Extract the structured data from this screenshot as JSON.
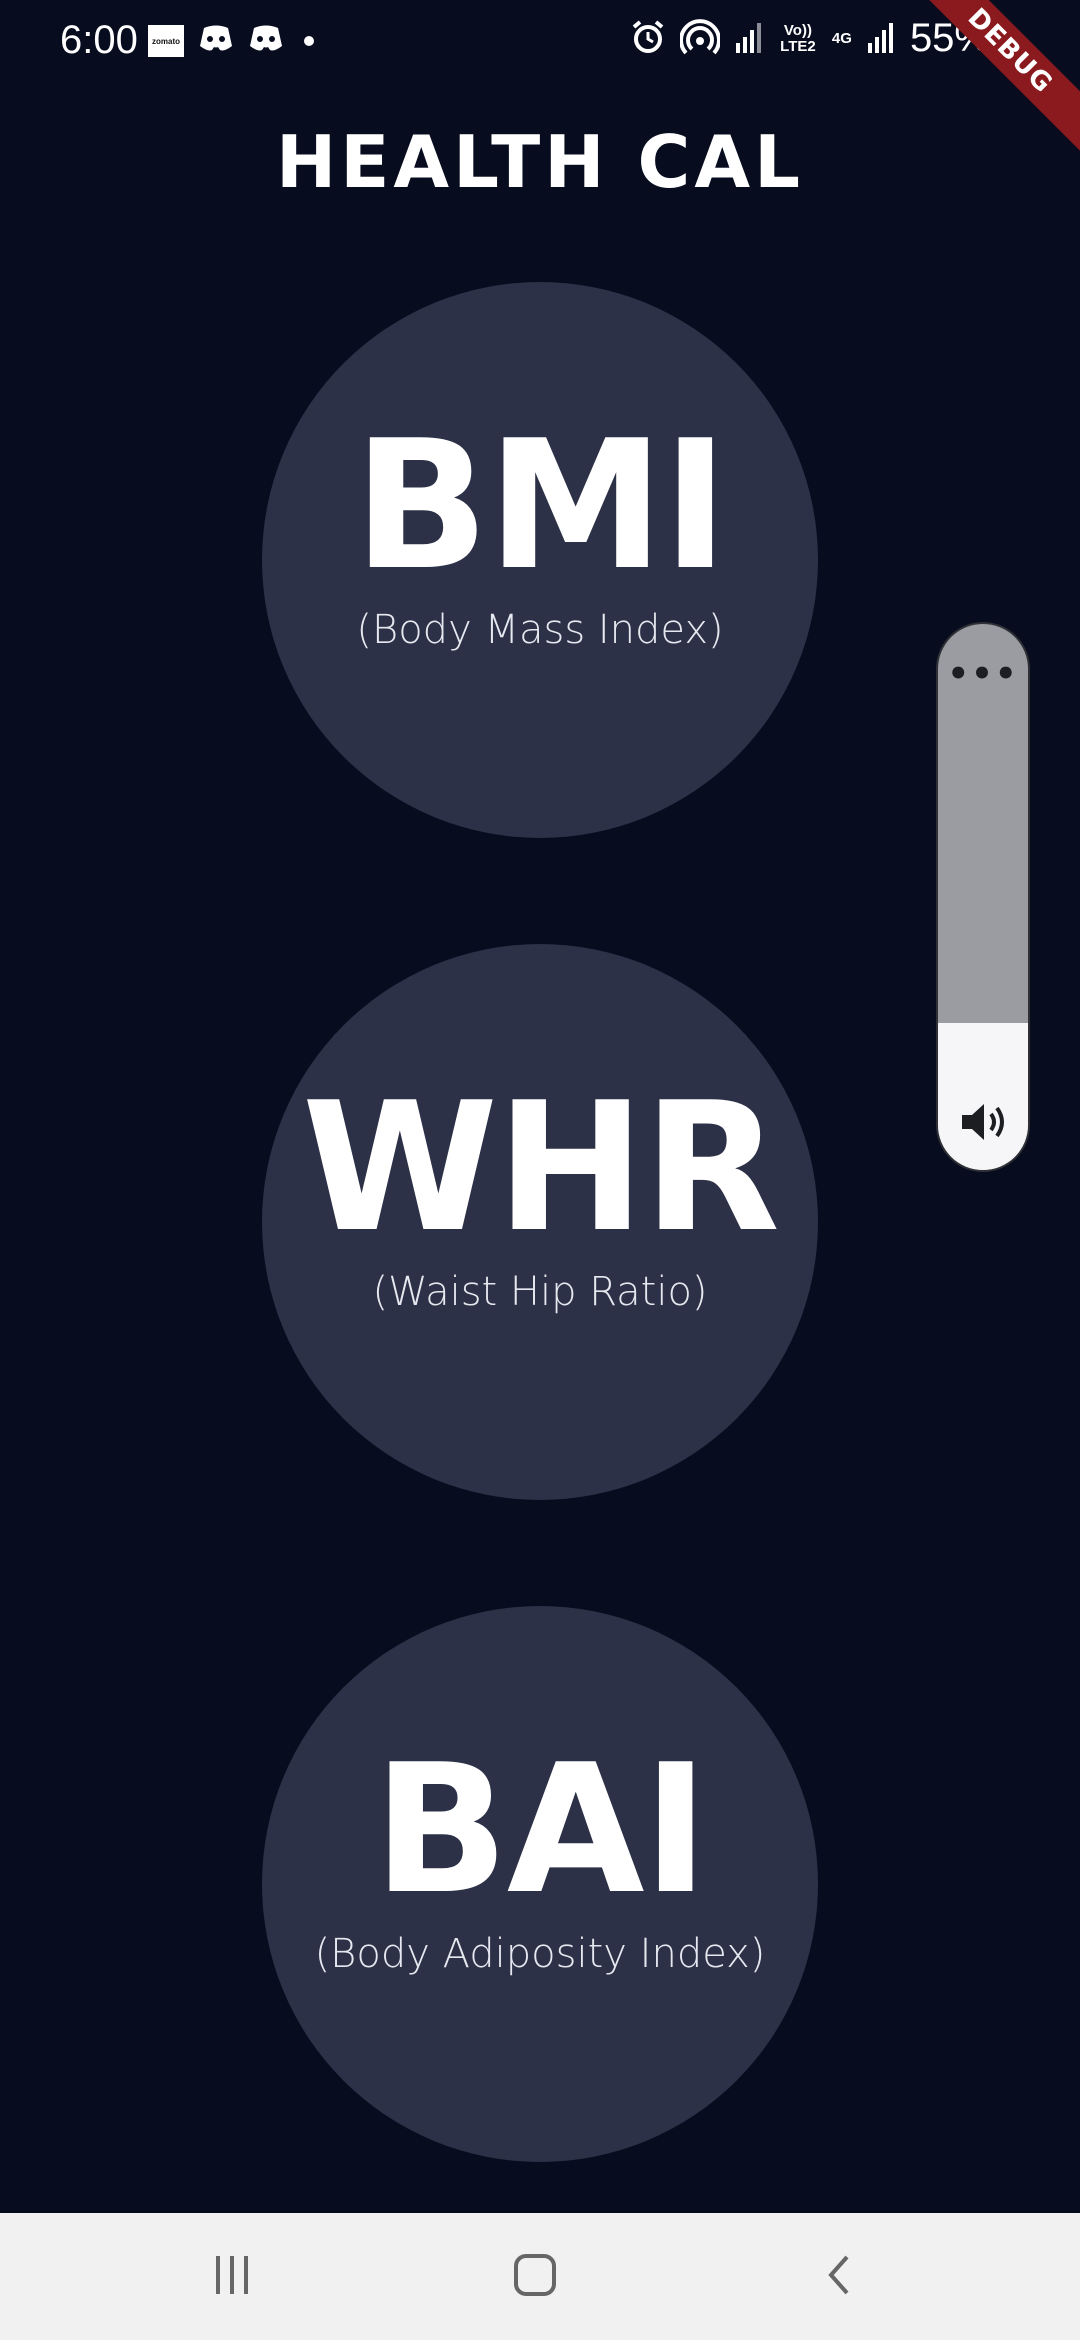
{
  "status_bar": {
    "time": "6:00",
    "app_notification": "zomato",
    "network_volte": "Vo)) LTE2",
    "network_type": "4G",
    "battery": "55%"
  },
  "debug_banner": "DEBUG",
  "app": {
    "title": "HEALTH CAL"
  },
  "calculators": [
    {
      "abbr": "BMI",
      "subtitle": "(Body Mass Index)"
    },
    {
      "abbr": "WHR",
      "subtitle": "(Waist Hip Ratio)"
    },
    {
      "abbr": "BAI",
      "subtitle": "(Body Adiposity Index)"
    }
  ],
  "volume": {
    "level": 0.27,
    "more_label": "•••"
  },
  "nav": {
    "recents": "recents-icon",
    "home": "home-icon",
    "back": "back-icon"
  },
  "colors": {
    "background": "#070c1f",
    "circle": "#2c3147",
    "debug": "#8b1a1e"
  }
}
